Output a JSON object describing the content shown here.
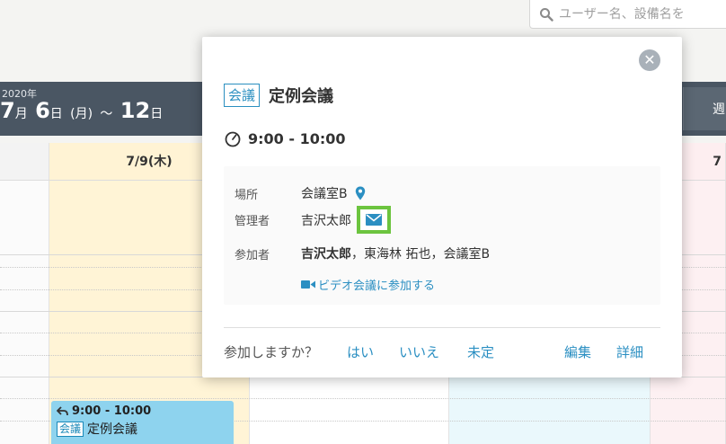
{
  "search": {
    "placeholder": "ユーザー名、設備名を"
  },
  "calendar": {
    "year": "2020年",
    "range_start_month": "7",
    "range_start_day": "6",
    "range_start_dow": "(月)",
    "range_sep": "～",
    "range_end_prefix": "12",
    "range_end_unit": "日",
    "month_unit": "月",
    "day_unit": "日",
    "week_button": "週",
    "columns": [
      {
        "label": ""
      },
      {
        "label": "7/9(木)"
      },
      {
        "label": ""
      },
      {
        "label": ""
      },
      {
        "label": "7"
      }
    ],
    "event": {
      "time": "9:00 - 10:00",
      "tag": "会議",
      "title": "定例会議"
    }
  },
  "popup": {
    "category": "会議",
    "title": "定例会議",
    "time": "9:00 - 10:00",
    "place_label": "場所",
    "place_value": "会議室B",
    "manager_label": "管理者",
    "manager_value": "吉沢太郎",
    "participants_label": "参加者",
    "participants_main": "吉沢太郎",
    "participants_rest": "，東海林 拓也，会議室B",
    "video_link": "ビデオ会議に参加する",
    "attend_question": "参加しますか？",
    "yes": "はい",
    "no": "いいえ",
    "undecided": "未定",
    "edit": "編集",
    "details": "詳細"
  },
  "colors": {
    "accent": "#2b8fc2",
    "header_band": "#4a5663",
    "highlight": "#6cc43f",
    "today_column": "#fff4d6",
    "event_card": "#8ed3ee"
  }
}
